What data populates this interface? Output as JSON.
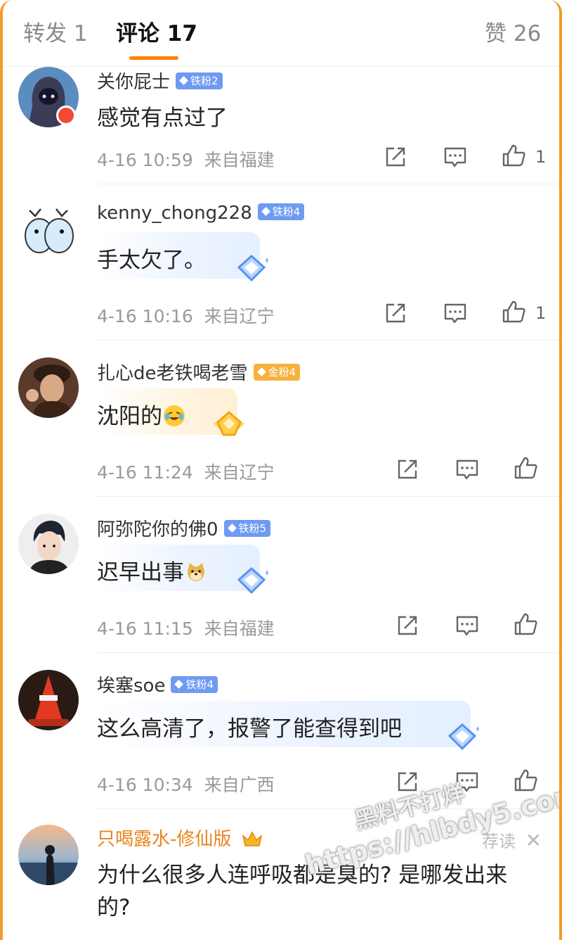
{
  "tabs": [
    {
      "label": "转发 1"
    },
    {
      "label": "评论 17"
    },
    {
      "label": "赞 26"
    }
  ],
  "comments": [
    {
      "username": "关你屁士",
      "fan_badge": "铁粉2",
      "text": "感觉有点过了",
      "time": "4-16 10:59",
      "location": "来自福建",
      "likes": "1"
    },
    {
      "username": "kenny_chong228",
      "fan_badge": "铁粉4",
      "text": "手太欠了。",
      "time": "4-16 10:16",
      "location": "来自辽宁",
      "likes": "1"
    },
    {
      "username": "扎心de老铁喝老雪",
      "fan_badge": "金粉4",
      "text": "沈阳的",
      "time": "4-16 11:24",
      "location": "来自辽宁",
      "likes": ""
    },
    {
      "username": "阿弥陀你的佛0",
      "fan_badge": "铁粉5",
      "text": "迟早出事",
      "time": "4-16 11:15",
      "location": "来自福建",
      "likes": ""
    },
    {
      "username": "埃塞soe",
      "fan_badge": "铁粉4",
      "text": "这么高清了，报警了能查得到吧",
      "time": "4-16 10:34",
      "location": "来自广西",
      "likes": ""
    },
    {
      "username": "只喝露水-修仙版",
      "text_line1": "为什么很多人连呼吸都是臭的? 是哪发出来",
      "text_line2": "的?",
      "recommend_label": "荐读"
    }
  ],
  "watermark": {
    "line1": "黑料不打烊",
    "line2": "https://hlbdy5.com"
  },
  "colors": {
    "accent": "#ff8200",
    "frame": "#f39b2a",
    "fan_blue": "#6e9bf2",
    "fan_gold": "#f6b13e",
    "vip_name": "#e8851a"
  },
  "icons": [
    "share-icon",
    "comment-icon",
    "like-icon",
    "close-icon",
    "crown-icon",
    "fan-gem-icon",
    "laughing-crying-emoji-icon",
    "doge-emoji-icon"
  ]
}
